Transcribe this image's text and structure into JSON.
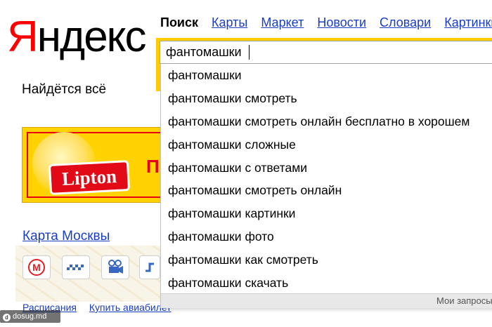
{
  "logo": {
    "first_letter": "Я",
    "rest": "ндекс"
  },
  "tagline": "Найдётся всё",
  "services": {
    "current": "Поиск",
    "links": [
      "Карты",
      "Маркет",
      "Новости",
      "Словари",
      "Картинки"
    ]
  },
  "search": {
    "value": "фантомашки"
  },
  "suggestions": {
    "items": [
      "фантомашки",
      "фантомашки смотреть",
      "фантомашки смотреть онлайн бесплатно в хорошем",
      "фантомашки сложные",
      "фантомашки с ответами",
      "фантомашки смотреть онлайн",
      "фантомашки картинки",
      "фантомашки фото",
      "фантомашки как смотреть",
      "фантомашки скачать"
    ],
    "footer": "Мои запросы"
  },
  "banner": {
    "brand": "Lipton",
    "text_fragment": "П"
  },
  "map": {
    "link": "Карта Москвы",
    "icons": [
      "metro-icon",
      "taxi-icon",
      "camera-icon",
      "route-icon"
    ]
  },
  "bottom_links": [
    "Расписания",
    "Купить авиабилет"
  ],
  "watermark": {
    "text": "dosug.md",
    "mark": "d"
  },
  "colors": {
    "brand_red": "#ff0000",
    "link_blue": "#1a3dc1",
    "search_yellow": "#ffcc00",
    "lipton_red": "#e20a17"
  }
}
